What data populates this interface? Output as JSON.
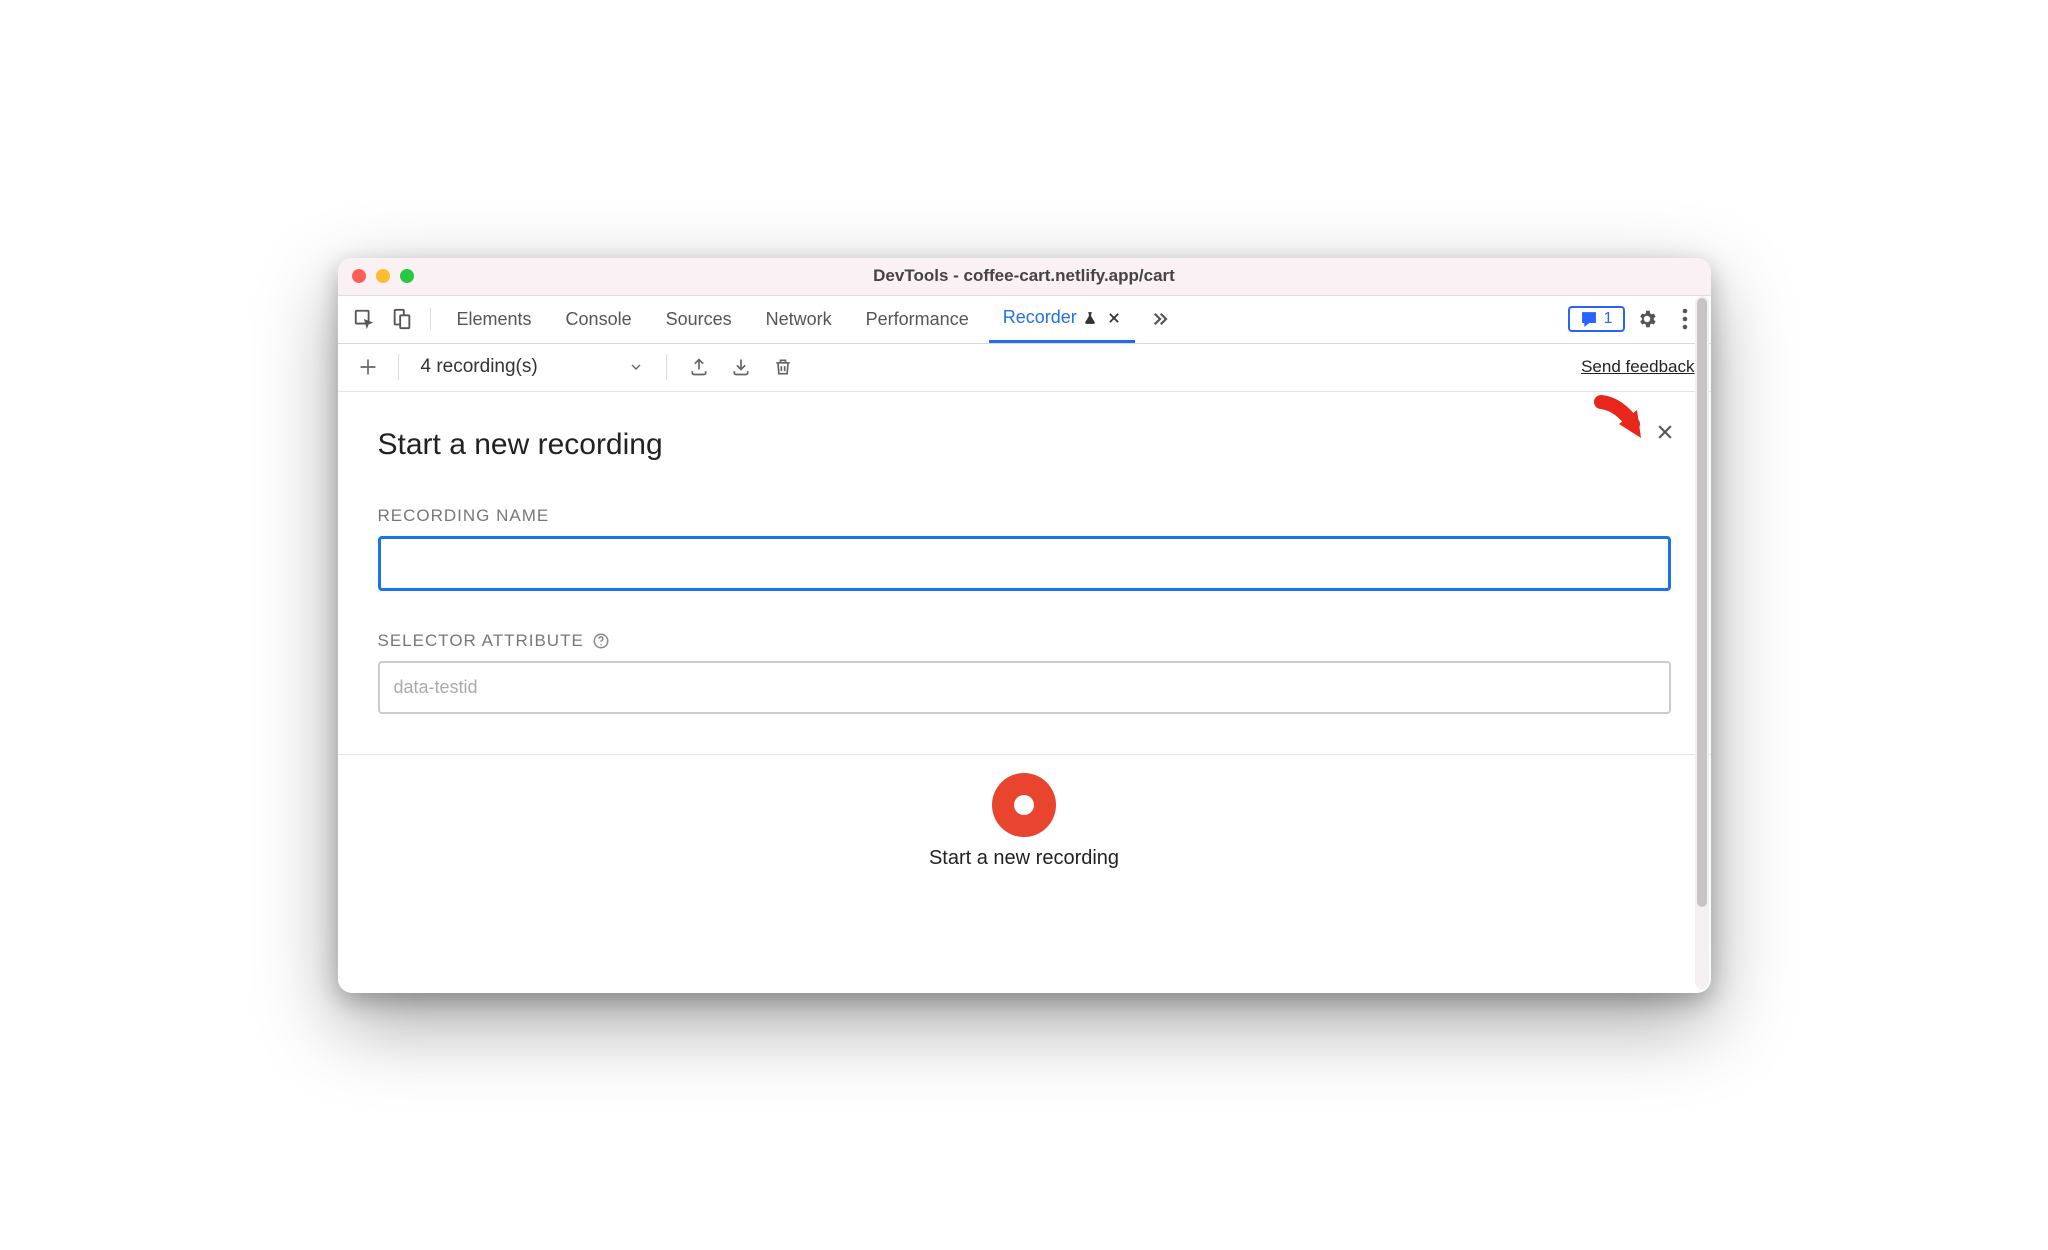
{
  "window": {
    "title": "DevTools - coffee-cart.netlify.app/cart"
  },
  "tabs": {
    "items": [
      "Elements",
      "Console",
      "Sources",
      "Network",
      "Performance"
    ],
    "active": {
      "label": "Recorder"
    },
    "feedback_count": "1"
  },
  "toolbar": {
    "dropdown_label": "4 recording(s)",
    "send_feedback": "Send feedback"
  },
  "panel": {
    "title": "Start a new recording",
    "recording_name_label": "RECORDING NAME",
    "recording_name_value": "",
    "selector_attr_label": "SELECTOR ATTRIBUTE",
    "selector_attr_placeholder": "data-testid",
    "selector_attr_value": ""
  },
  "footer": {
    "record_label": "Start a new recording"
  }
}
